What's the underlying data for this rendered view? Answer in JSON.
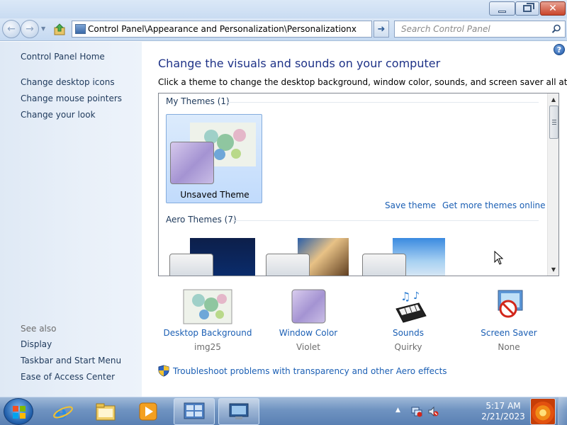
{
  "titlebar": {
    "minimize_glyph": "",
    "close_glyph": "✕"
  },
  "navbar": {
    "address_text": "Control Panel\\Appearance and Personalization\\Personalizationx",
    "search_placeholder": "Search Control Panel"
  },
  "sidebar": {
    "home_link": "Control Panel Home",
    "tasks": [
      "Change desktop icons",
      "Change mouse pointers",
      "Change your look"
    ],
    "see_also_heading": "See also",
    "see_also_links": [
      "Display",
      "Taskbar and Start Menu",
      "Ease of Access Center"
    ]
  },
  "main": {
    "help_glyph": "?",
    "heading": "Change the visuals and sounds on your computer",
    "subheading": "Click a theme to change the desktop background, window color, sounds, and screen saver all at once.",
    "my_themes_label": "My Themes (1)",
    "selected_theme_name": "Unsaved Theme",
    "save_theme_link": "Save theme",
    "more_themes_link": "Get more themes online",
    "aero_themes_label": "Aero Themes (7)",
    "settings": [
      {
        "label": "Desktop Background",
        "value": "img25"
      },
      {
        "label": "Window Color",
        "value": "Violet"
      },
      {
        "label": "Sounds",
        "value": "Quirky"
      },
      {
        "label": "Screen Saver",
        "value": "None"
      }
    ],
    "troubleshoot_link": "Troubleshoot problems with transparency and other Aero effects"
  },
  "taskbar": {
    "time": "5:17 AM",
    "date": "2/21/2023",
    "tray_arrow": "▲"
  },
  "colors": {
    "link_blue": "#1b5fb4",
    "heading_blue": "#1e3287",
    "window_color_violet": "#a493d2",
    "close_red": "#c9452b"
  }
}
